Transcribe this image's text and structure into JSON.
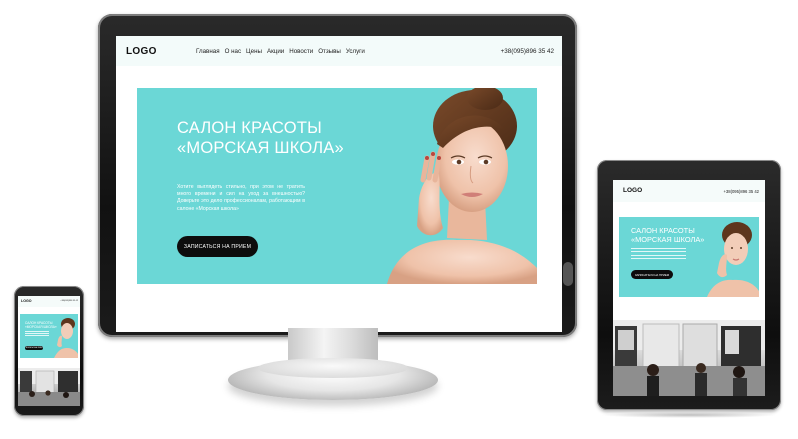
{
  "site": {
    "logo": "LOGO",
    "nav": [
      "Главная",
      "О нас",
      "Цены",
      "Акции",
      "Новости",
      "Отзывы",
      "Услуги"
    ],
    "phone": "+38(095)896 35 42",
    "tablet_phone": "+38(095)896 35 42",
    "hero_title_line1": "САЛОН КРАСОТЫ",
    "hero_title_line2": "«МОРСКАЯ ШКОЛА»",
    "hero_text": "Хотите выглядеть стильно, при этом не тратить много времени и сил на уход за внешностью? Доверьте это дело профессионалам, работающим в салоне «Морская школа»",
    "cta_label": "ЗАПИСАТЬСЯ НА ПРИЕМ"
  },
  "colors": {
    "accent": "#6bd7d6",
    "button": "#0d0d0d",
    "header_bg": "#f3fbfa"
  },
  "icons": {
    "hero_image": "woman-portrait-image",
    "salon_image": "salon-interior-image"
  }
}
